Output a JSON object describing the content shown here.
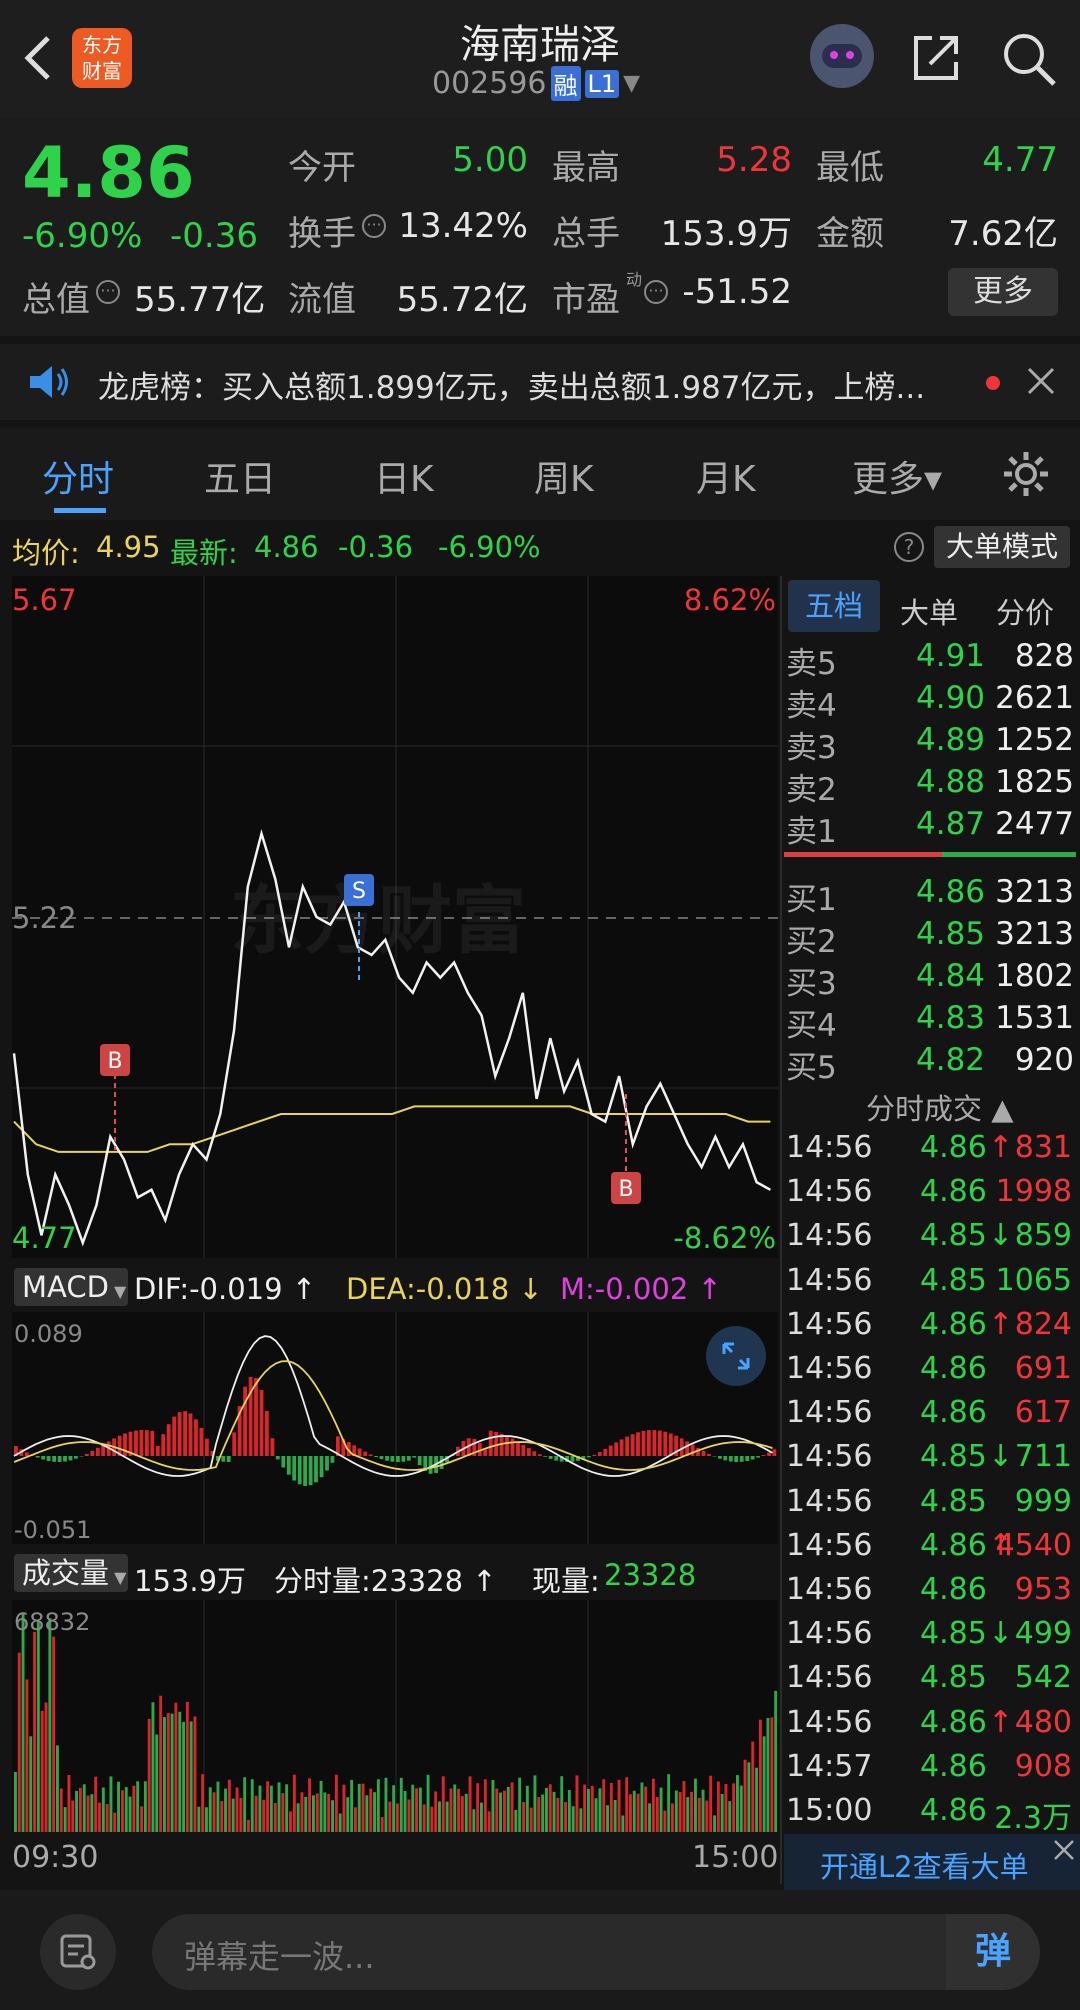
{
  "header": {
    "title": "海南瑞泽",
    "code": "002596",
    "badge_rong": "融",
    "badge_l1": "L1",
    "logo_line1": "东方",
    "logo_line2": "财富"
  },
  "quote": {
    "price": "4.86",
    "change_pct": "-6.90%",
    "change_amt": "-0.36",
    "open_label": "今开",
    "open": "5.00",
    "high_label": "最高",
    "high": "5.28",
    "low_label": "最低",
    "low": "4.77",
    "turnover_label": "换手",
    "turnover": "13.42%",
    "volume_label": "总手",
    "volume": "153.9万",
    "amount_label": "金额",
    "amount": "7.62亿",
    "mktcap_label": "总值",
    "mktcap": "55.77亿",
    "float_label": "流值",
    "float": "55.72亿",
    "pe_label": "市盈",
    "pe_sup": "动",
    "pe": "-51.52",
    "more_button": "更多"
  },
  "notice": {
    "text": "龙虎榜：买入总额1.899亿元，卖出总额1.987亿元，上榜..."
  },
  "tabs": [
    {
      "label": "分时"
    },
    {
      "label": "五日"
    },
    {
      "label": "日K"
    },
    {
      "label": "周K"
    },
    {
      "label": "月K"
    },
    {
      "label": "更多▾"
    }
  ],
  "info_bar": {
    "avg_label": "均价:",
    "avg": "4.95",
    "latest_label": "最新:",
    "latest": "4.86",
    "chg": "-0.36",
    "pct": "-6.90%",
    "big_order_button": "大单模式"
  },
  "chart": {
    "top_price": "5.67",
    "top_pct": "8.62%",
    "bottom_price": "4.77",
    "bottom_pct": "-8.62%",
    "ref_price": "5.22",
    "time_start": "09:30",
    "time_end": "15:00",
    "watermark": "东方财富",
    "marker_s": "S",
    "marker_b": "B"
  },
  "macd": {
    "selector": "MACD",
    "dif": "DIF:-0.019",
    "dea": "DEA:-0.018",
    "m": "M:-0.002",
    "max": "0.089",
    "min": "-0.051"
  },
  "vol_panel": {
    "selector": "成交量",
    "total": "153.9万",
    "period_label": "分时量:23328",
    "now_label": "现量:",
    "now": "23328",
    "max": "68832"
  },
  "orderbook": {
    "tabs": [
      "五档",
      "大单",
      "分价"
    ],
    "asks": [
      {
        "label": "卖5",
        "price": "4.91",
        "vol": "828"
      },
      {
        "label": "卖4",
        "price": "4.90",
        "vol": "2621"
      },
      {
        "label": "卖3",
        "price": "4.89",
        "vol": "1252"
      },
      {
        "label": "卖2",
        "price": "4.88",
        "vol": "1825"
      },
      {
        "label": "卖1",
        "price": "4.87",
        "vol": "2477"
      }
    ],
    "bids": [
      {
        "label": "买1",
        "price": "4.86",
        "vol": "3213"
      },
      {
        "label": "买2",
        "price": "4.85",
        "vol": "3213"
      },
      {
        "label": "买3",
        "price": "4.84",
        "vol": "1802"
      },
      {
        "label": "买4",
        "price": "4.83",
        "vol": "1531"
      },
      {
        "label": "买5",
        "price": "4.82",
        "vol": "920"
      }
    ]
  },
  "ticks": {
    "title": "分时成交",
    "rows": [
      {
        "time": "14:56",
        "price": "4.86",
        "arrow": "↑",
        "vol": "831",
        "dir": "up"
      },
      {
        "time": "14:56",
        "price": "4.86",
        "arrow": "",
        "vol": "1998",
        "dir": "up"
      },
      {
        "time": "14:56",
        "price": "4.85",
        "arrow": "↓",
        "vol": "859",
        "dir": "down"
      },
      {
        "time": "14:56",
        "price": "4.85",
        "arrow": "",
        "vol": "1065",
        "dir": "down"
      },
      {
        "time": "14:56",
        "price": "4.86",
        "arrow": "↑",
        "vol": "824",
        "dir": "up"
      },
      {
        "time": "14:56",
        "price": "4.86",
        "arrow": "",
        "vol": "691",
        "dir": "up"
      },
      {
        "time": "14:56",
        "price": "4.86",
        "arrow": "",
        "vol": "617",
        "dir": "up"
      },
      {
        "time": "14:56",
        "price": "4.85",
        "arrow": "↓",
        "vol": "711",
        "dir": "down"
      },
      {
        "time": "14:56",
        "price": "4.85",
        "arrow": "",
        "vol": "999",
        "dir": "down"
      },
      {
        "time": "14:56",
        "price": "4.86",
        "arrow": "↑",
        "vol": "4540",
        "dir": "up"
      },
      {
        "time": "14:56",
        "price": "4.86",
        "arrow": "",
        "vol": "953",
        "dir": "up"
      },
      {
        "time": "14:56",
        "price": "4.85",
        "arrow": "↓",
        "vol": "499",
        "dir": "down"
      },
      {
        "time": "14:56",
        "price": "4.85",
        "arrow": "",
        "vol": "542",
        "dir": "down"
      },
      {
        "time": "14:56",
        "price": "4.86",
        "arrow": "↑",
        "vol": "480",
        "dir": "up"
      },
      {
        "time": "14:57",
        "price": "4.86",
        "arrow": "",
        "vol": "908",
        "dir": "up"
      },
      {
        "time": "15:00",
        "price": "4.86",
        "arrow": "",
        "vol": "2.3万",
        "dir": "down"
      }
    ],
    "l2_link": "开通L2查看大单"
  },
  "bottom": {
    "danmaku_placeholder": "弹幕走一波...",
    "danmaku_button": "弹"
  },
  "colors": {
    "up": "#f0353a",
    "down": "#2ed24b",
    "accent": "#4aa3ff",
    "avg": "#e8d45c"
  },
  "chart_data": {
    "type": "line",
    "title": "",
    "xlabel": "",
    "ylabel": "",
    "x_range": [
      "09:30",
      "15:00"
    ],
    "ylim": [
      4.77,
      5.67
    ],
    "reference_price": 5.22,
    "series": [
      {
        "values": [
          5.04,
          4.88,
          4.8,
          4.88,
          4.84,
          4.79,
          4.84,
          4.93,
          4.9,
          4.85,
          4.86,
          4.82,
          4.88,
          4.92,
          4.9,
          4.96,
          5.07,
          5.26,
          5.33,
          5.27,
          5.18,
          5.26,
          5.22,
          5.21,
          5.24,
          5.18,
          5.17,
          5.19,
          5.14,
          5.12,
          5.16,
          5.14,
          5.16,
          5.12,
          5.09,
          5.01,
          5.06,
          5.12,
          4.98,
          5.06,
          4.99,
          5.03,
          4.96,
          4.95,
          5.01,
          4.92,
          4.97,
          5.0,
          4.96,
          4.92,
          4.89,
          4.93,
          4.89,
          4.92,
          4.87,
          4.86
        ]
      },
      {
        "values": [
          4.95,
          4.92,
          4.91,
          4.91,
          4.91,
          4.91,
          4.91,
          4.92,
          4.92,
          4.93,
          4.94,
          4.95,
          4.96,
          4.96,
          4.96,
          4.96,
          4.96,
          4.96,
          4.97,
          4.97,
          4.97,
          4.97,
          4.97,
          4.97,
          4.97,
          4.97,
          4.96,
          4.96,
          4.96,
          4.96,
          4.96,
          4.96,
          4.96,
          4.95,
          4.95
        ]
      }
    ]
  }
}
